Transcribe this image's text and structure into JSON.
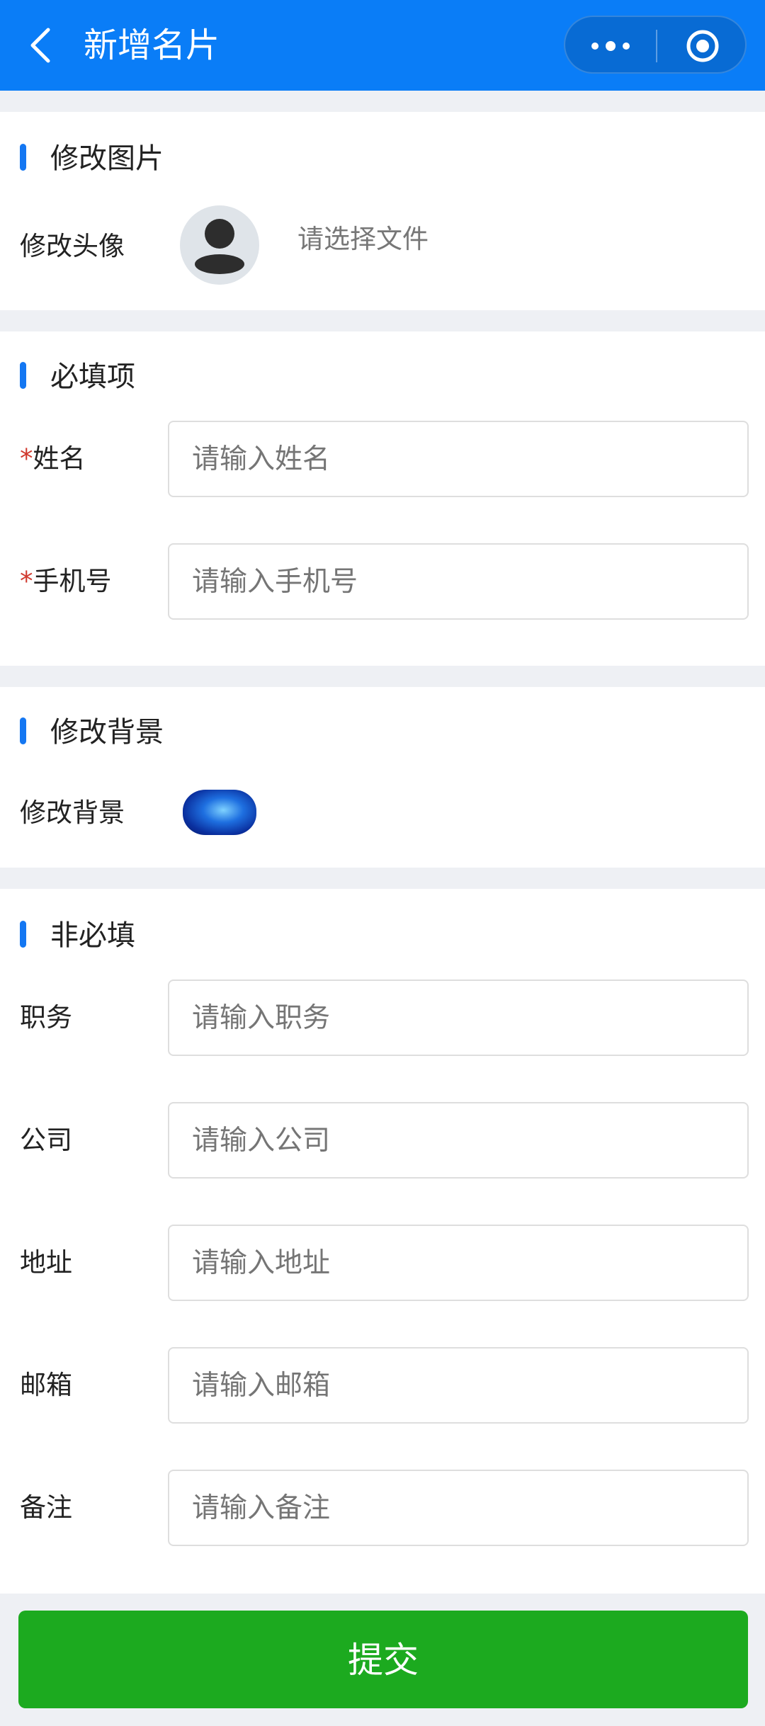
{
  "navbar": {
    "title": "新增名片",
    "back_icon": "chevron-left-icon",
    "more_icon": "more-dots-icon",
    "close_icon": "target-circle-icon"
  },
  "section_image": {
    "title": "修改图片",
    "avatar_label": "修改头像",
    "file_hint": "请选择文件"
  },
  "section_required": {
    "title": "必填项",
    "required_mark": "*",
    "name_label": "姓名",
    "name_placeholder": "请输入姓名",
    "phone_label": "手机号",
    "phone_placeholder": "请输入手机号"
  },
  "section_background": {
    "title": "修改背景",
    "bg_label": "修改背景"
  },
  "section_optional": {
    "title": "非必填",
    "fields": [
      {
        "label": "职务",
        "placeholder": "请输入职务"
      },
      {
        "label": "公司",
        "placeholder": "请输入公司"
      },
      {
        "label": "地址",
        "placeholder": "请输入地址"
      },
      {
        "label": "邮箱",
        "placeholder": "请输入邮箱"
      },
      {
        "label": "备注",
        "placeholder": "请输入备注"
      }
    ]
  },
  "submit": {
    "label": "提交"
  },
  "colors": {
    "navbar": "#0a7df7",
    "accent_bar": "#1477f2",
    "required_star": "#d13a2f",
    "submit": "#1caa1f"
  }
}
